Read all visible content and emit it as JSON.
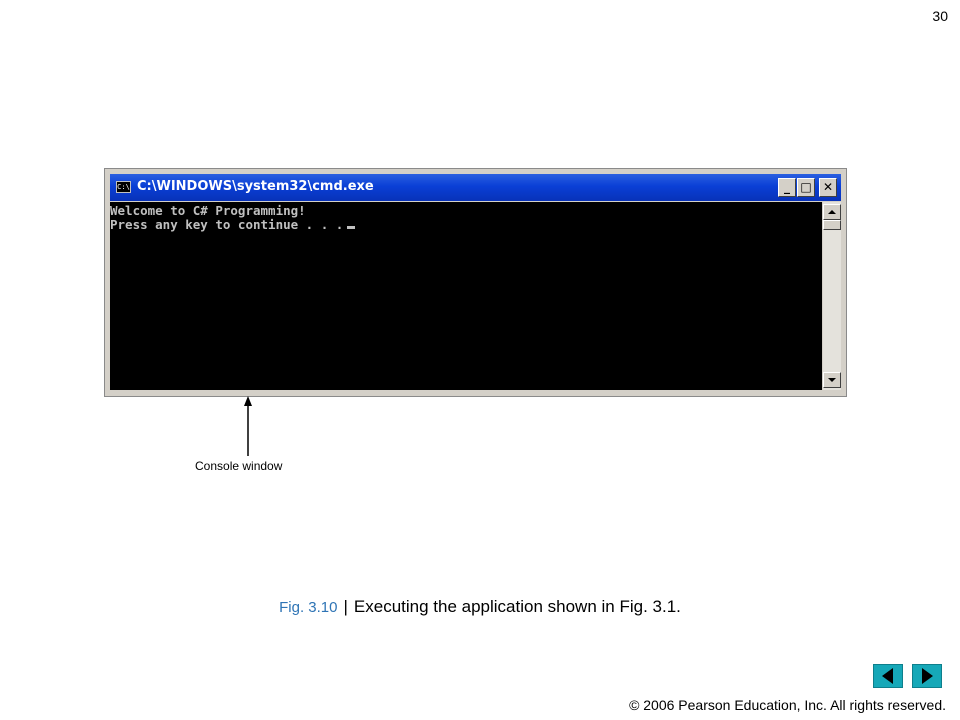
{
  "slide": {
    "page_number": "30",
    "copyright": "© 2006 Pearson Education, Inc.  All rights reserved."
  },
  "window": {
    "icon_text": "C:\\",
    "title": "C:\\WINDOWS\\system32\\cmd.exe",
    "buttons": {
      "minimize": "_",
      "maximize": "□",
      "close": "✕"
    },
    "console_lines": [
      "Welcome to C# Programming!",
      "Press any key to continue . . ."
    ]
  },
  "annotation": {
    "label": "Console window"
  },
  "caption": {
    "figure_label": "Fig. 3.10",
    "separator": "|",
    "text": "Executing the application shown in Fig. 3.1."
  },
  "navigation": {
    "prev_icon": "triangle-left-icon",
    "next_icon": "triangle-right-icon",
    "color": "#16a8b8"
  },
  "colors": {
    "titlebar": "#0a3fd6",
    "console_bg": "#000000",
    "console_text": "#c0c0c0",
    "figure_label": "#2e74b5"
  }
}
